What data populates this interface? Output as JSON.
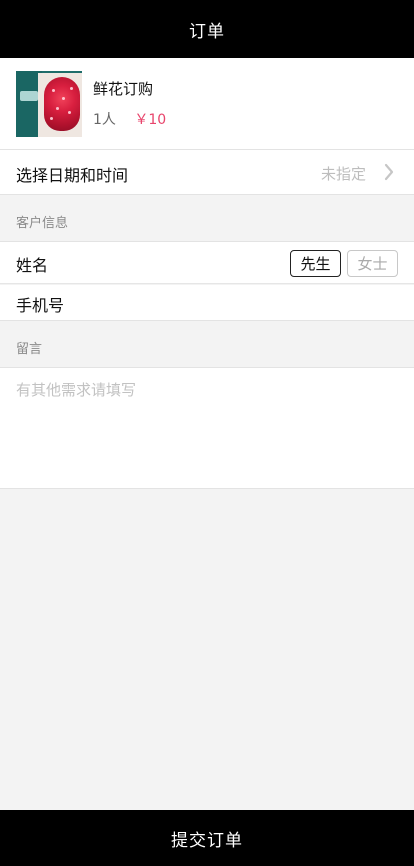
{
  "header": {
    "title": "订单"
  },
  "product": {
    "name": "鲜花订购",
    "count": "1人",
    "price": "￥10"
  },
  "datetime": {
    "label": "选择日期和时间",
    "value": "未指定"
  },
  "customer": {
    "section_label": "客户信息",
    "name_label": "姓名",
    "gender_options": [
      "先生",
      "女士"
    ],
    "gender_selected": "先生",
    "phone_label": "手机号"
  },
  "message": {
    "section_label": "留言",
    "placeholder": "有其他需求请填写"
  },
  "footer": {
    "submit_label": "提交订单"
  },
  "colors": {
    "accent_price": "#e8456c",
    "bar": "#000000"
  }
}
